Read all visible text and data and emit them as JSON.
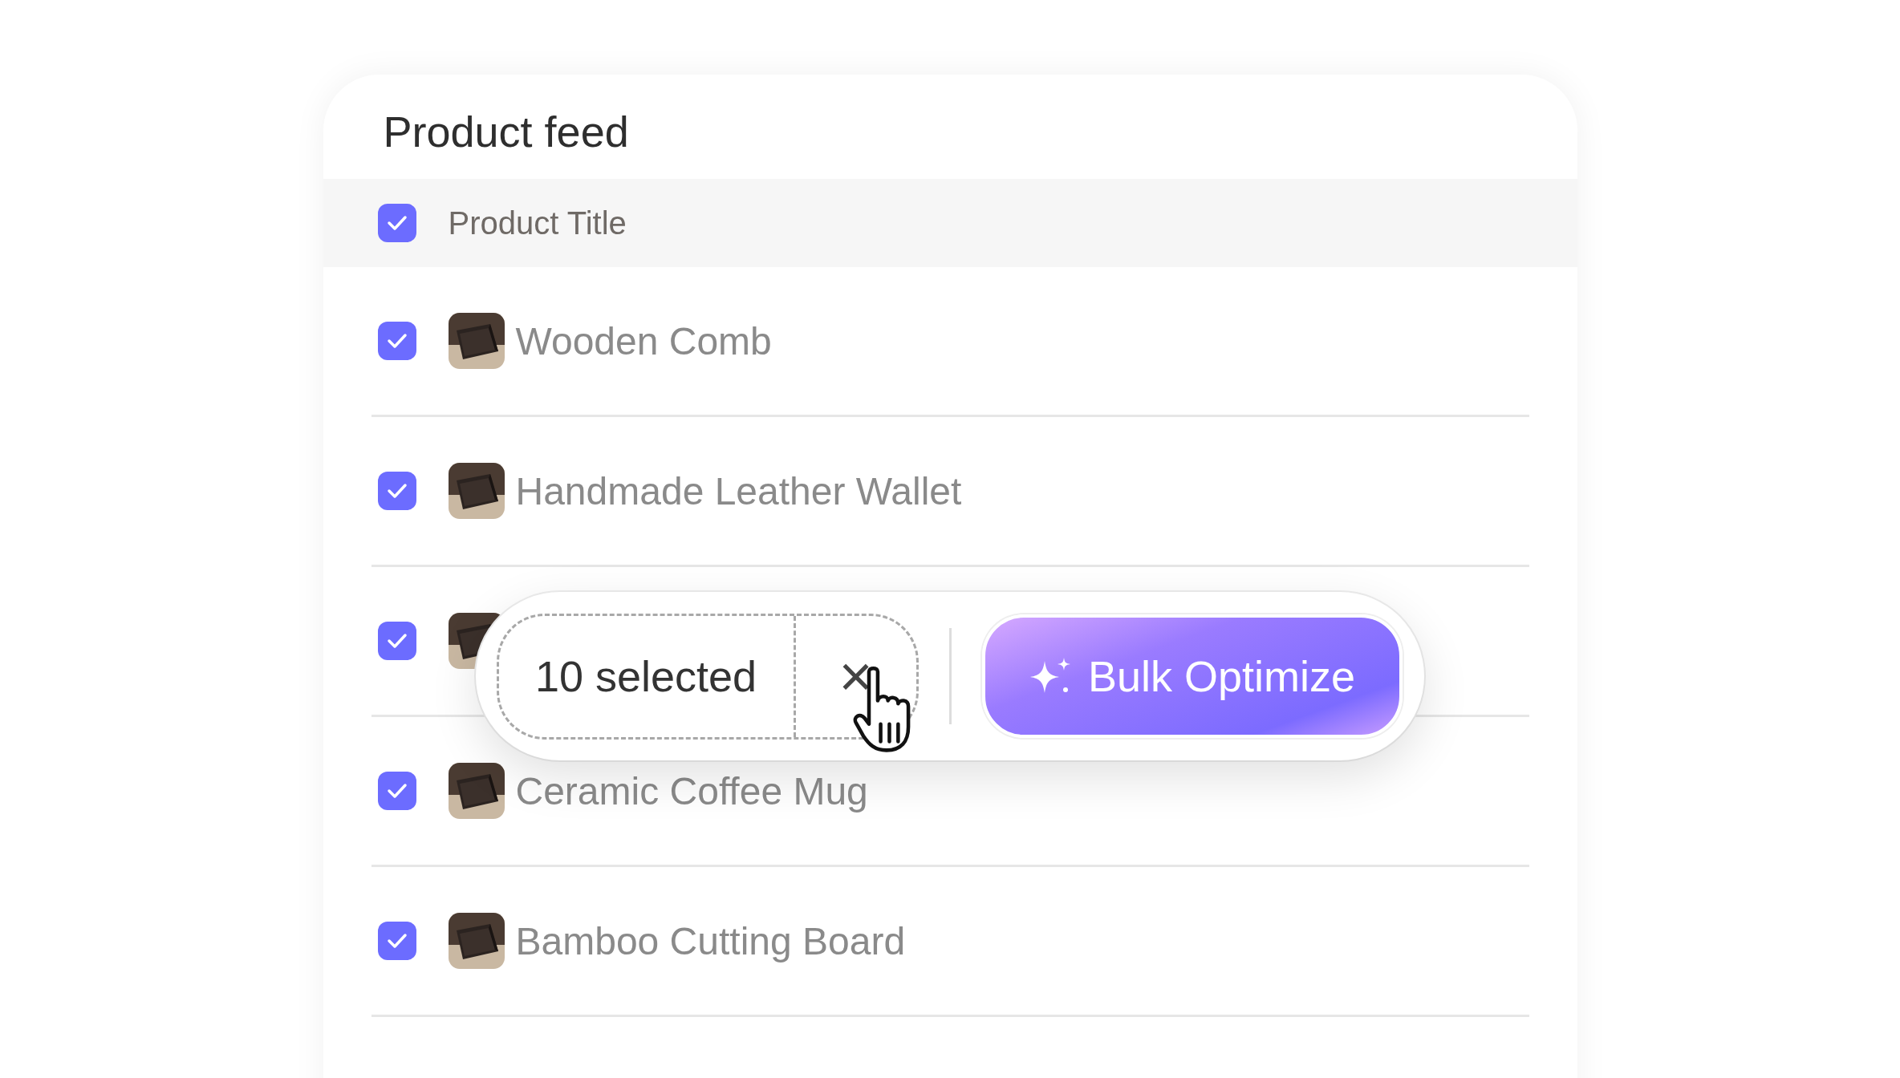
{
  "card": {
    "title": "Product feed"
  },
  "table": {
    "header": {
      "label": "Product Title",
      "checked": true
    },
    "rows": [
      {
        "title": "Wooden Comb",
        "checked": true
      },
      {
        "title": "Handmade Leather Wallet",
        "checked": true
      },
      {
        "checked": true
      },
      {
        "title": "Ceramic Coffee Mug",
        "checked": true
      },
      {
        "title": "Bamboo Cutting Board",
        "checked": true
      }
    ]
  },
  "selection_bar": {
    "count": "10 selected",
    "close": "×",
    "action": "Bulk Optimize"
  }
}
